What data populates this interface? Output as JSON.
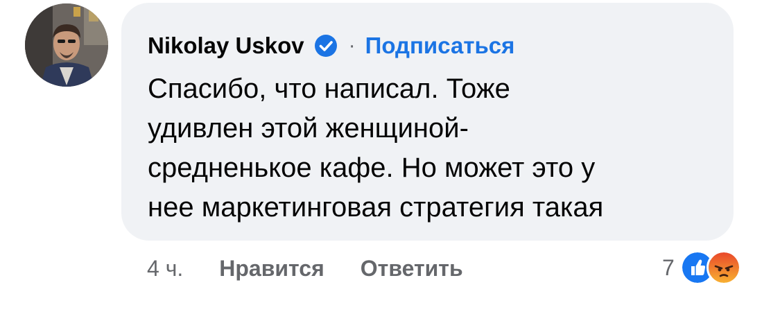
{
  "comment": {
    "author": "Nikolay Uskov",
    "separator": "·",
    "subscribe_label": "Подписаться",
    "text_lines": [
      "Спасибо, что написал. Тоже",
      "удивлен этой женщиной-",
      "средненькое кафе. Но может это у",
      "нее маркетинговая стратегия такая"
    ],
    "time": "4 ч.",
    "like_label": "Нравится",
    "reply_label": "Ответить",
    "reaction_count": "7",
    "reaction_icons": [
      "like-icon",
      "angry-icon"
    ]
  },
  "colors": {
    "bubble": "#f0f2f5",
    "link": "#1b74e4",
    "secondary_text": "#65676b",
    "verified": "#1b74e4",
    "like": "#1877f2",
    "angry": "#f5533d"
  }
}
